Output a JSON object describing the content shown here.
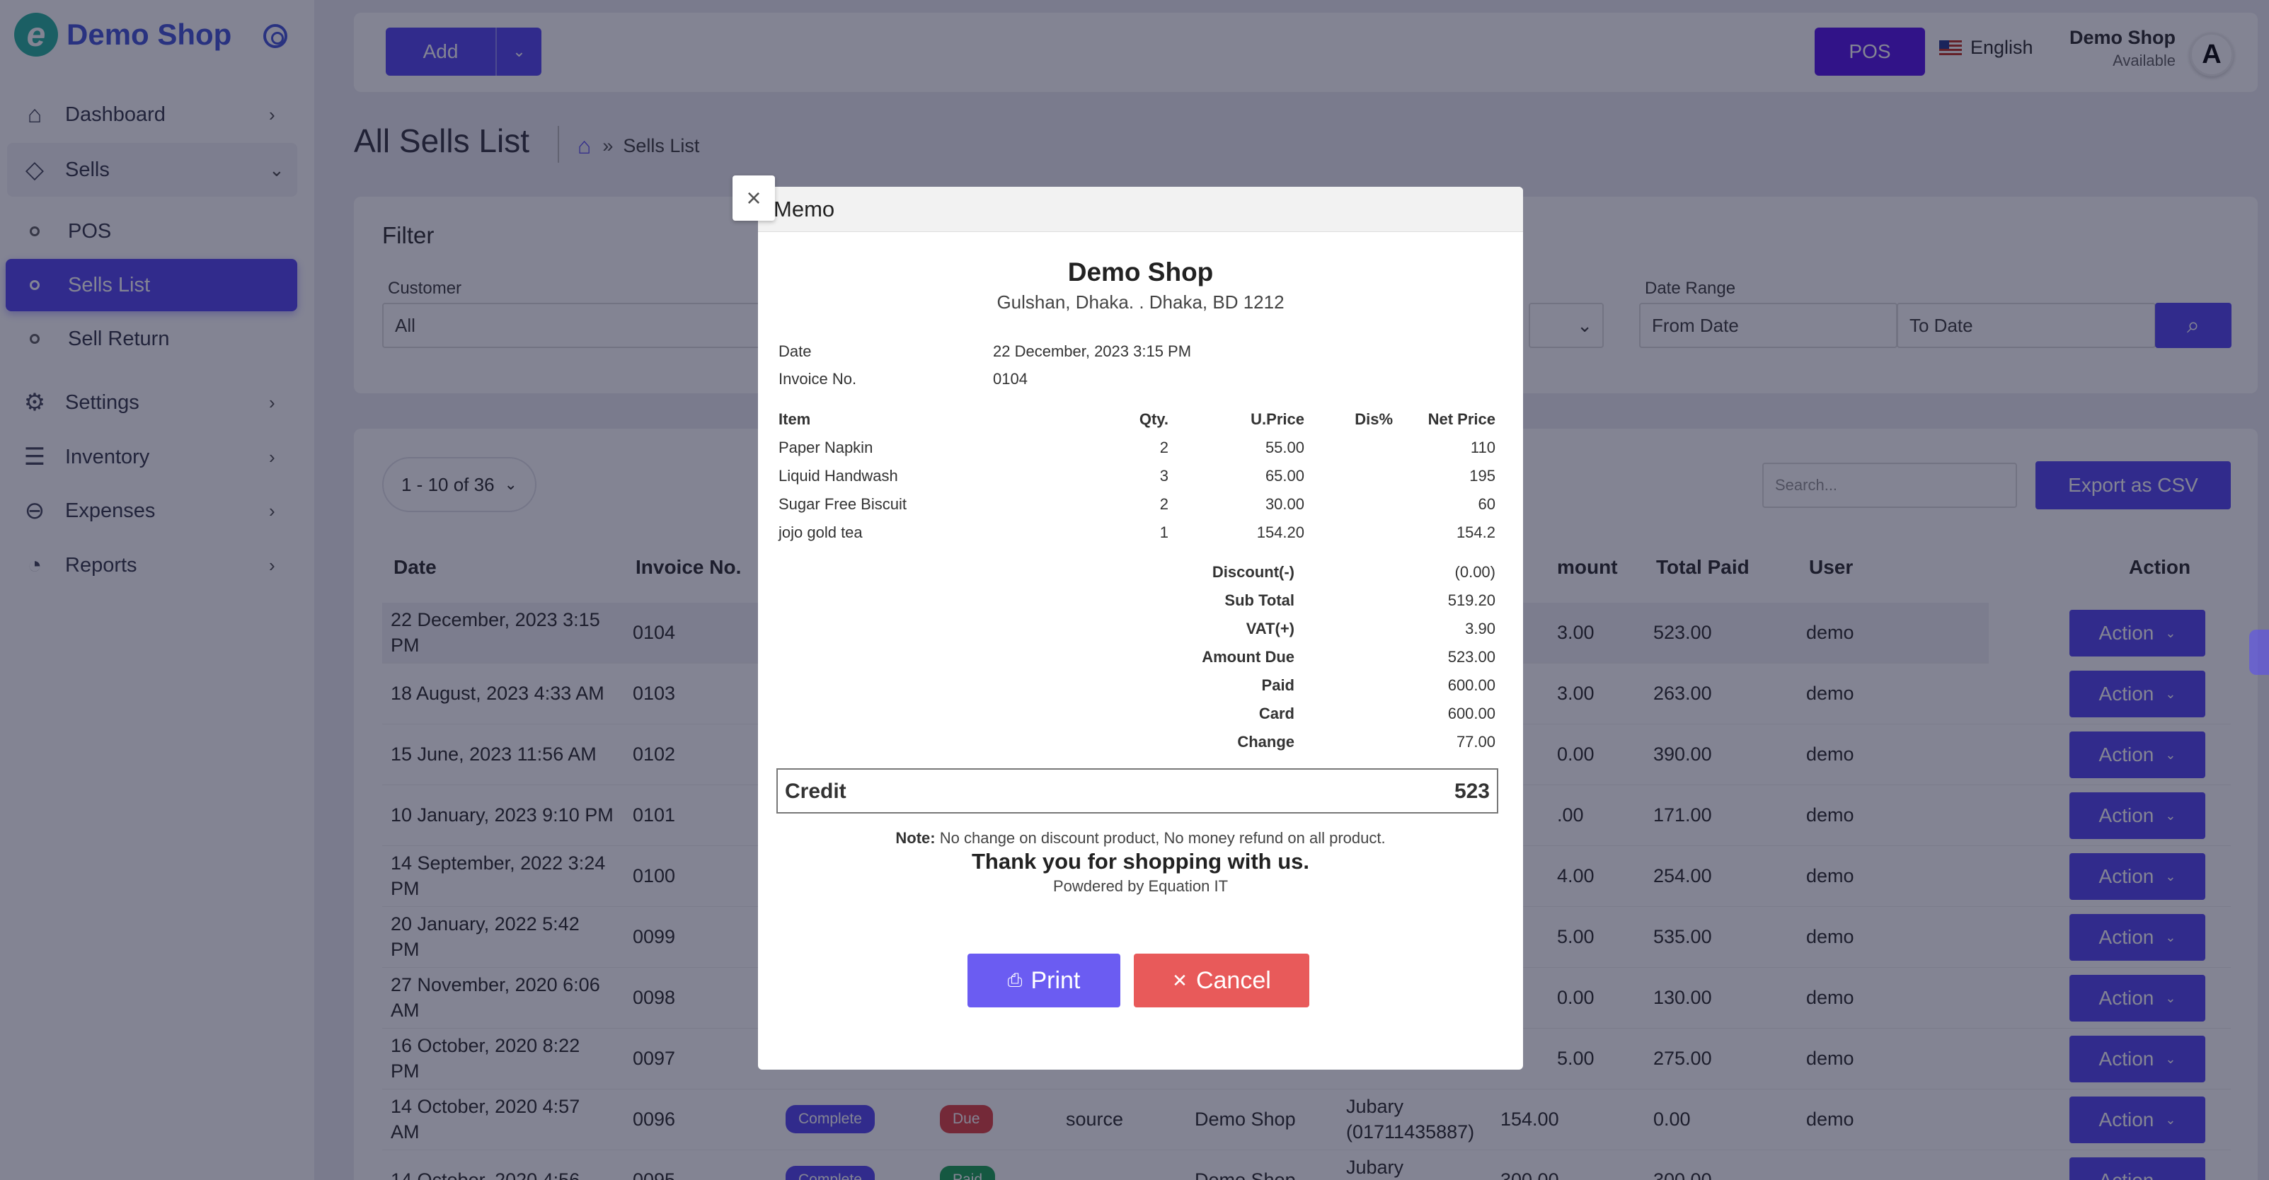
{
  "app": {
    "name": "Demo Shop"
  },
  "sidebar": {
    "items": [
      {
        "label": "Dashboard",
        "icon": "home-icon",
        "glyph": "⌂"
      },
      {
        "label": "Sells",
        "icon": "tag-icon",
        "glyph": "◇"
      },
      {
        "label": "Settings",
        "icon": "gear-icon",
        "glyph": "⚙"
      },
      {
        "label": "Inventory",
        "icon": "database-icon",
        "glyph": "☰"
      },
      {
        "label": "Expenses",
        "icon": "minus-circle-icon",
        "glyph": "⊖"
      },
      {
        "label": "Reports",
        "icon": "pie-chart-icon",
        "glyph": "◔"
      }
    ],
    "sells_sub": [
      "POS",
      "Sells List",
      "Sell Return"
    ]
  },
  "topbar": {
    "add_label": "Add",
    "pos_label": "POS",
    "language": "English",
    "user_name": "Demo Shop",
    "user_status": "Available",
    "avatar_letter": "A"
  },
  "page": {
    "title": "All Sells List",
    "breadcrumb": "Sells List"
  },
  "filter": {
    "title": "Filter",
    "customer_label": "Customer",
    "customer_value": "All",
    "date_range_label": "Date Range",
    "from_placeholder": "From Date",
    "to_placeholder": "To Date"
  },
  "table": {
    "pager": "1 - 10 of 36",
    "search_placeholder": "Search...",
    "export_label": "Export as CSV",
    "headers": [
      "Date",
      "Invoice No.",
      "mount",
      "Total Paid",
      "User",
      "Action"
    ],
    "action_label": "Action",
    "rows": [
      {
        "date": [
          "22 December, 2023 3:15",
          "PM"
        ],
        "invoice": "0104",
        "amount": "3.00",
        "paid": "523.00",
        "user": "demo"
      },
      {
        "date": [
          "18 August, 2023 4:33 AM"
        ],
        "invoice": "0103",
        "amount": "3.00",
        "paid": "263.00",
        "user": "demo"
      },
      {
        "date": [
          "15 June, 2023 11:56 AM"
        ],
        "invoice": "0102",
        "amount": "0.00",
        "paid": "390.00",
        "user": "demo"
      },
      {
        "date": [
          "10 January, 2023 9:10 PM"
        ],
        "invoice": "0101",
        "amount": ".00",
        "paid": "171.00",
        "user": "demo"
      },
      {
        "date": [
          "14 September, 2022 3:24",
          "PM"
        ],
        "invoice": "0100",
        "amount": "4.00",
        "paid": "254.00",
        "user": "demo"
      },
      {
        "date": [
          "20 January, 2022 5:42",
          "PM"
        ],
        "invoice": "0099",
        "amount": "5.00",
        "paid": "535.00",
        "user": "demo"
      },
      {
        "date": [
          "27 November, 2020 6:06",
          "AM"
        ],
        "invoice": "0098",
        "amount": "0.00",
        "paid": "130.00",
        "user": "demo"
      },
      {
        "date": [
          "16 October, 2020 8:22",
          "PM"
        ],
        "invoice": "0097",
        "amount": "5.00",
        "paid": "275.00",
        "user": "demo"
      },
      {
        "date": [
          "14 October, 2020 4:57",
          "AM"
        ],
        "invoice": "0096",
        "status": "Complete",
        "payment": "Due",
        "source": "source",
        "shop": "Demo Shop",
        "customer": [
          "Jubary",
          "(01711435887)"
        ],
        "amount": "154.00",
        "paid": "0.00",
        "user": "demo"
      },
      {
        "date": [
          "14 October, 2020 4:56"
        ],
        "invoice": "0095",
        "status": "Complete",
        "payment": "Paid",
        "source": "",
        "shop": "Demo Shop",
        "customer": [
          "Jubary"
        ],
        "amount": "300.00",
        "paid": "300.00",
        "user": ""
      }
    ]
  },
  "memo": {
    "title": "Memo",
    "shop_name": "Demo Shop",
    "shop_address": "Gulshan, Dhaka. . Dhaka, BD 1212",
    "date_label": "Date",
    "date_value": "22 December, 2023 3:15 PM",
    "invoice_label": "Invoice No.",
    "invoice_value": "0104",
    "columns": {
      "item": "Item",
      "qty": "Qty.",
      "uprice": "U.Price",
      "dis": "Dis%",
      "net": "Net Price"
    },
    "items": [
      {
        "name": "Paper Napkin",
        "qty": "2",
        "uprice": "55.00",
        "dis": "",
        "net": "110"
      },
      {
        "name": "Liquid Handwash",
        "qty": "3",
        "uprice": "65.00",
        "dis": "",
        "net": "195"
      },
      {
        "name": "Sugar Free Biscuit",
        "qty": "2",
        "uprice": "30.00",
        "dis": "",
        "net": "60"
      },
      {
        "name": "jojo gold tea",
        "qty": "1",
        "uprice": "154.20",
        "dis": "",
        "net": "154.2"
      }
    ],
    "totals": [
      {
        "label": "Discount(-)",
        "value": "(0.00)"
      },
      {
        "label": "Sub Total",
        "value": "519.20"
      },
      {
        "label": "VAT(+)",
        "value": "3.90"
      },
      {
        "label": "Amount Due",
        "value": "523.00"
      },
      {
        "label": "Paid",
        "value": "600.00"
      },
      {
        "label": "Card",
        "value": "600.00"
      },
      {
        "label": "Change",
        "value": "77.00"
      }
    ],
    "credit_label": "Credit",
    "credit_value": "523",
    "note_label": "Note:",
    "note_text": "No change on discount product, No money refund on all product.",
    "thanks": "Thank you for shopping with us.",
    "powered": "Powdered by Equation IT",
    "print_label": "Print",
    "cancel_label": "Cancel"
  },
  "colors": {
    "accent": "#5a4df0",
    "danger": "#e85a5a",
    "success": "#22a65a",
    "logo": "#2fb5a0"
  }
}
